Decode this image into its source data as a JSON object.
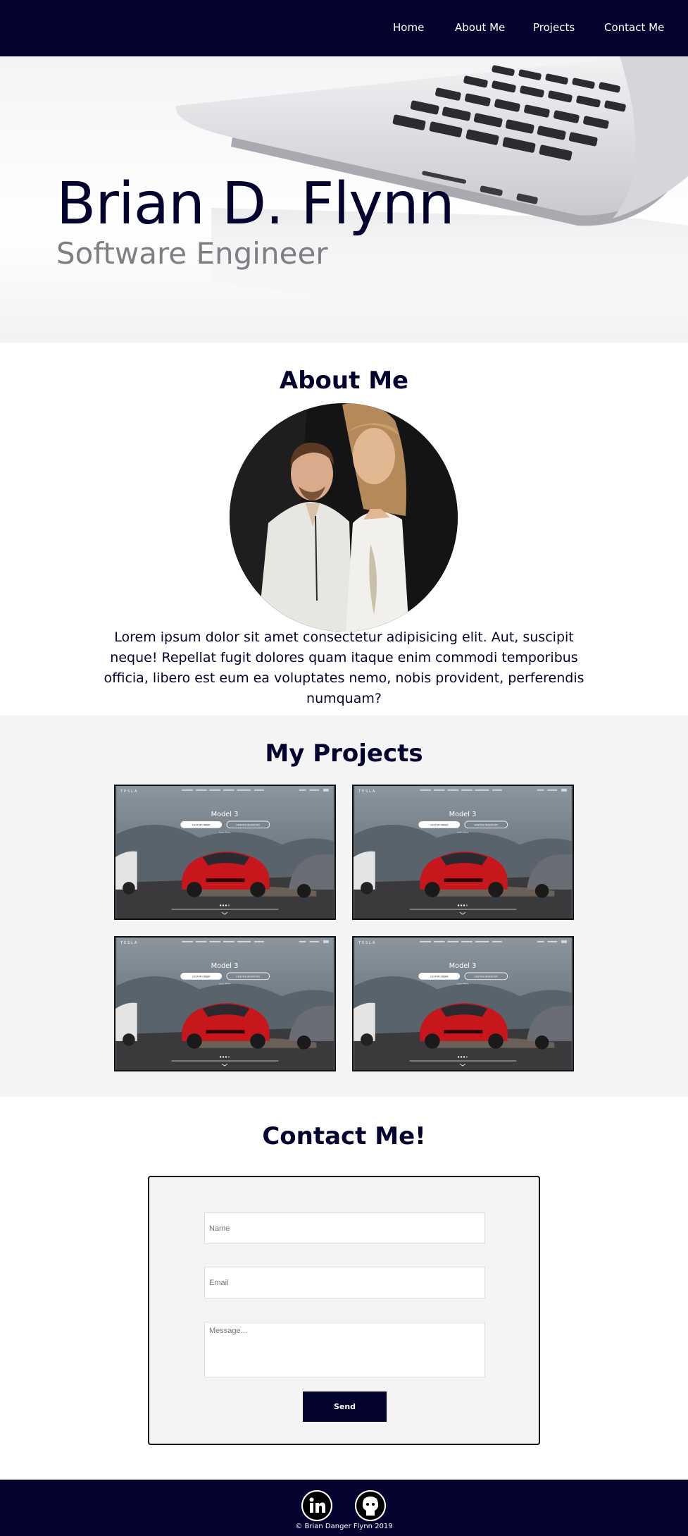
{
  "nav": {
    "links": [
      {
        "label": "Home"
      },
      {
        "label": "About Me"
      },
      {
        "label": "Projects"
      },
      {
        "label": "Contact Me"
      }
    ]
  },
  "hero": {
    "name": "Brian D. Flynn",
    "title": "Software Engineer"
  },
  "about": {
    "heading": "About Me",
    "text": "Lorem ipsum dolor sit amet consectetur adipisicing elit. Aut, suscipit neque! Repellat fugit dolores quam itaque enim commodi temporibus officia, libero est eum ea voluptates nemo, nobis provident, perferendis numquam?"
  },
  "projects": {
    "heading": "My Projects",
    "cards": [
      {
        "logo": "TESLA",
        "model": "Model 3",
        "primary_button": "CUSTOM ORDER",
        "secondary_button": "EXISTING INVENTORY",
        "link": "Learn More"
      },
      {
        "logo": "TESLA",
        "model": "Model 3",
        "primary_button": "CUSTOM ORDER",
        "secondary_button": "EXISTING INVENTORY",
        "link": "Learn More"
      },
      {
        "logo": "TESLA",
        "model": "Model 3",
        "primary_button": "CUSTOM ORDER",
        "secondary_button": "EXISTING INVENTORY",
        "link": "Learn More"
      },
      {
        "logo": "TESLA",
        "model": "Model 3",
        "primary_button": "CUSTOM ORDER",
        "secondary_button": "EXISTING INVENTORY",
        "link": "Learn More"
      }
    ]
  },
  "contact": {
    "heading": "Contact Me!",
    "name_placeholder": "Name",
    "email_placeholder": "Email",
    "message_placeholder": "Message...",
    "send_label": "Send"
  },
  "footer": {
    "social": [
      {
        "icon": "linkedin-icon"
      },
      {
        "icon": "github-icon"
      }
    ],
    "copyright": "© Brian Danger Flynn 2019"
  },
  "colors": {
    "navy": "#04022f",
    "muted_gray": "#7e7e84",
    "section_gray": "#f4f4f4",
    "car_red": "#c8161d"
  }
}
